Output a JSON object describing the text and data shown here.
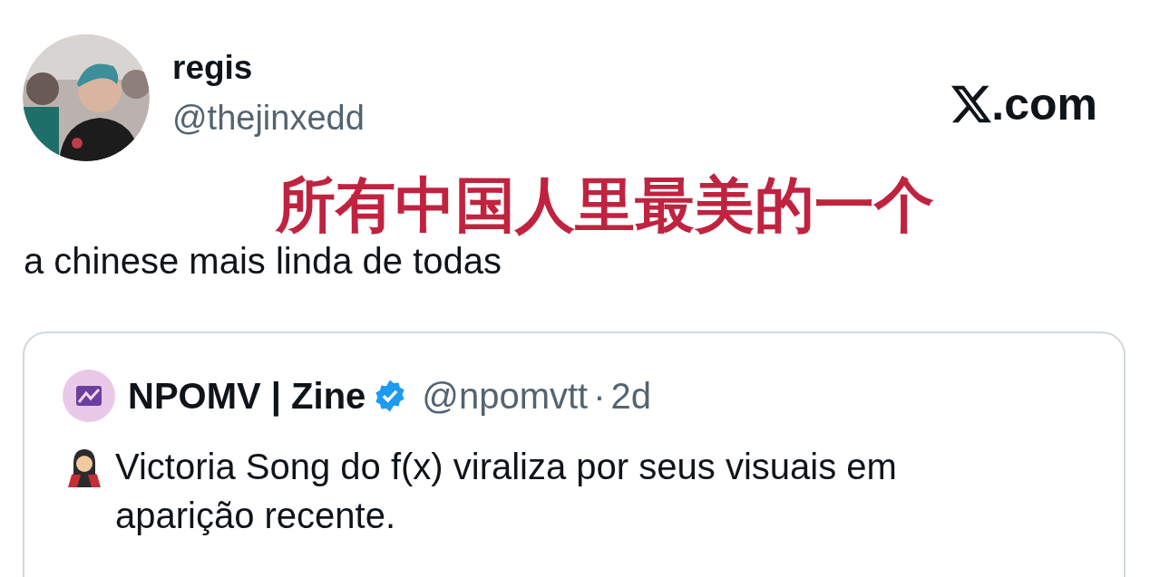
{
  "author": {
    "name": "regis",
    "handle": "@thejinxedd"
  },
  "brand": {
    "text": ".com"
  },
  "annotation": "所有中国人里最美的一个",
  "tweet_text": "a chinese mais linda de todas",
  "quote": {
    "author": {
      "name": "NPOMV | Zine",
      "verified": true,
      "handle": "@npomvtt",
      "separator": "·",
      "time": "2d"
    },
    "text": "Victoria Song do f(x) viraliza por seus visuais em aparição recente."
  }
}
